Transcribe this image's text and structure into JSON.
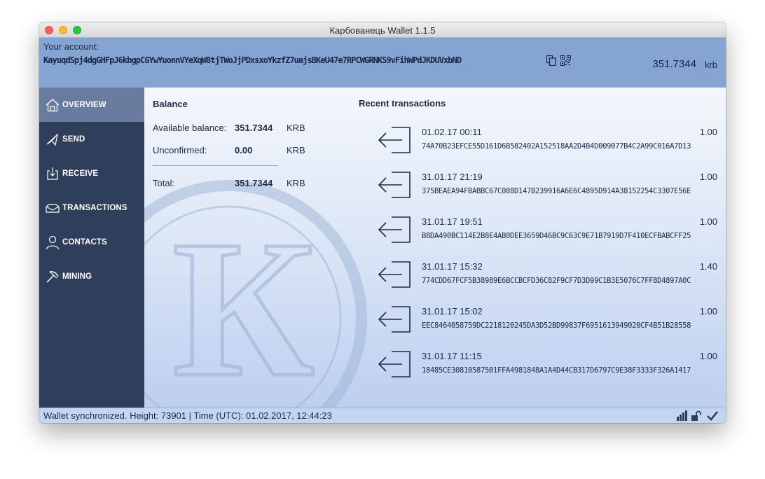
{
  "window": {
    "title": "Карбованець Wallet 1.1.5"
  },
  "account": {
    "label": "Your account:",
    "address": "KayuqdSpj4dgGHFpJ6kbgpCGYwYuonnVYeXqW8tjTWoJjPDxsxoYkzfZ7uajsBKeU47e7RPCWGRNKS9vFihWPdJKDUVxbND",
    "balance": "351.7344",
    "unit": "krb"
  },
  "sidebar": {
    "items": [
      {
        "label": "OVERVIEW",
        "icon": "home-icon",
        "active": true
      },
      {
        "label": "SEND",
        "icon": "send-icon",
        "active": false
      },
      {
        "label": "RECEIVE",
        "icon": "receive-icon",
        "active": false
      },
      {
        "label": "TRANSACTIONS",
        "icon": "transactions-icon",
        "active": false
      },
      {
        "label": "CONTACTS",
        "icon": "contacts-icon",
        "active": false
      },
      {
        "label": "MINING",
        "icon": "mining-icon",
        "active": false
      }
    ]
  },
  "balance": {
    "title": "Balance",
    "available": {
      "label": "Available balance:",
      "value": "351.7344",
      "unit": "KRB"
    },
    "unconfirmed": {
      "label": "Unconfirmed:",
      "value": "0.00",
      "unit": "KRB"
    },
    "total": {
      "label": "Total:",
      "value": "351.7344",
      "unit": "KRB"
    }
  },
  "recent": {
    "title": "Recent transactions",
    "transactions": [
      {
        "date": "01.02.17 00:11",
        "amount": "1.00",
        "hash": "74A70B23EFCE55D161D6B582402A152518AA2D4B4D009077B4C2A99C016A7D13"
      },
      {
        "date": "31.01.17 21:19",
        "amount": "1.00",
        "hash": "375BEAEA94FBABBC67C088D147B239916A6E6C4895D914A38152254C3307E56E"
      },
      {
        "date": "31.01.17 19:51",
        "amount": "1.00",
        "hash": "B8DA490BC114E2B8E4AB0DEE3659D46BC9C63C9E71B7919D7F410ECFBABCFF25"
      },
      {
        "date": "31.01.17 15:32",
        "amount": "1.40",
        "hash": "774CDD67FCF5B38989E6BCCBCFD36C82F9CF7D3D99C1B3E5076C7FF8D4897A0C"
      },
      {
        "date": "31.01.17 15:02",
        "amount": "1.00",
        "hash": "EEC8464058759DC2218120245DA3D52BD99837F6951613949020CF4B51B28558"
      },
      {
        "date": "31.01.17 11:15",
        "amount": "1.00",
        "hash": "18485CE30810587501FFA4981848A1A4D44CB317D6797C9E38F3333F326A1417"
      }
    ]
  },
  "status": {
    "text": "Wallet synchronized. Height: 73901  |  Time (UTC): 01.02.2017, 12:44:23",
    "icons": [
      "signal-bars-icon",
      "unlocked-icon",
      "checkmark-icon"
    ]
  },
  "colors": {
    "header": "#86a4d2",
    "sidebar": "#2f3f5b",
    "sidebar_active": "#697c9f",
    "text": "#1d2b4a"
  }
}
